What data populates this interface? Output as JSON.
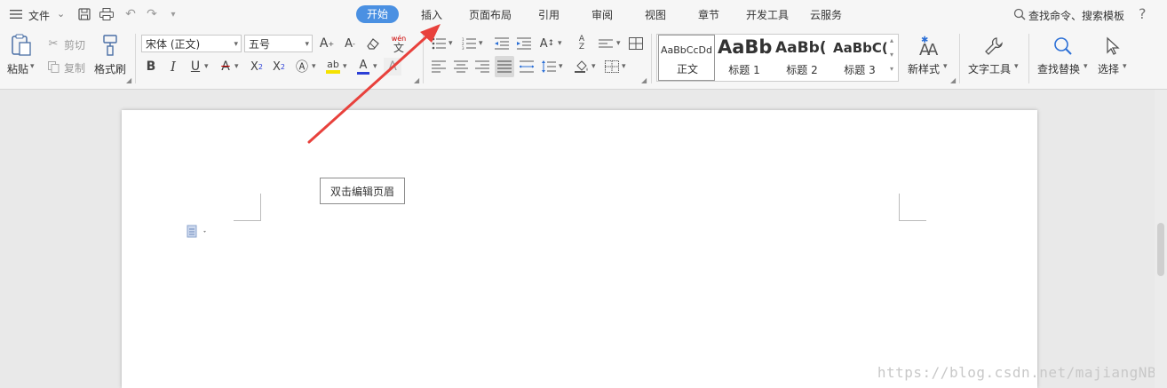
{
  "topbar": {
    "menu_icon": "hamburger-icon",
    "file_label": "文件",
    "tabs": [
      {
        "label": "开始",
        "active": true
      },
      {
        "label": "插入"
      },
      {
        "label": "页面布局"
      },
      {
        "label": "引用"
      },
      {
        "label": "审阅"
      },
      {
        "label": "视图"
      },
      {
        "label": "章节"
      },
      {
        "label": "开发工具"
      },
      {
        "label": "云服务"
      }
    ],
    "search_label": "查找命令、搜索模板",
    "help_label": "?"
  },
  "ribbon": {
    "paste_label": "粘贴",
    "cut_label": "剪切",
    "copy_label": "复制",
    "format_painter_label": "格式刷",
    "font_name": "宋体 (正文)",
    "font_size": "五号",
    "styles": [
      {
        "sample": "AaBbCcDd",
        "name": "正文"
      },
      {
        "sample": "AaBb",
        "name": "标题 1"
      },
      {
        "sample": "AaBb(",
        "name": "标题 2"
      },
      {
        "sample": "AaBbC(",
        "name": "标题 3"
      }
    ],
    "new_style_label": "新样式",
    "text_tools_label": "文字工具",
    "find_replace_label": "查找替换",
    "select_label": "选择"
  },
  "document": {
    "header_hint": "双击编辑页眉"
  },
  "watermark": "https://blog.csdn.net/majiangNB",
  "colors": {
    "accent": "#4a90e2",
    "arrow": "#e8413c",
    "highlight": "#f5e200",
    "font_color": "#2b3fd6"
  }
}
